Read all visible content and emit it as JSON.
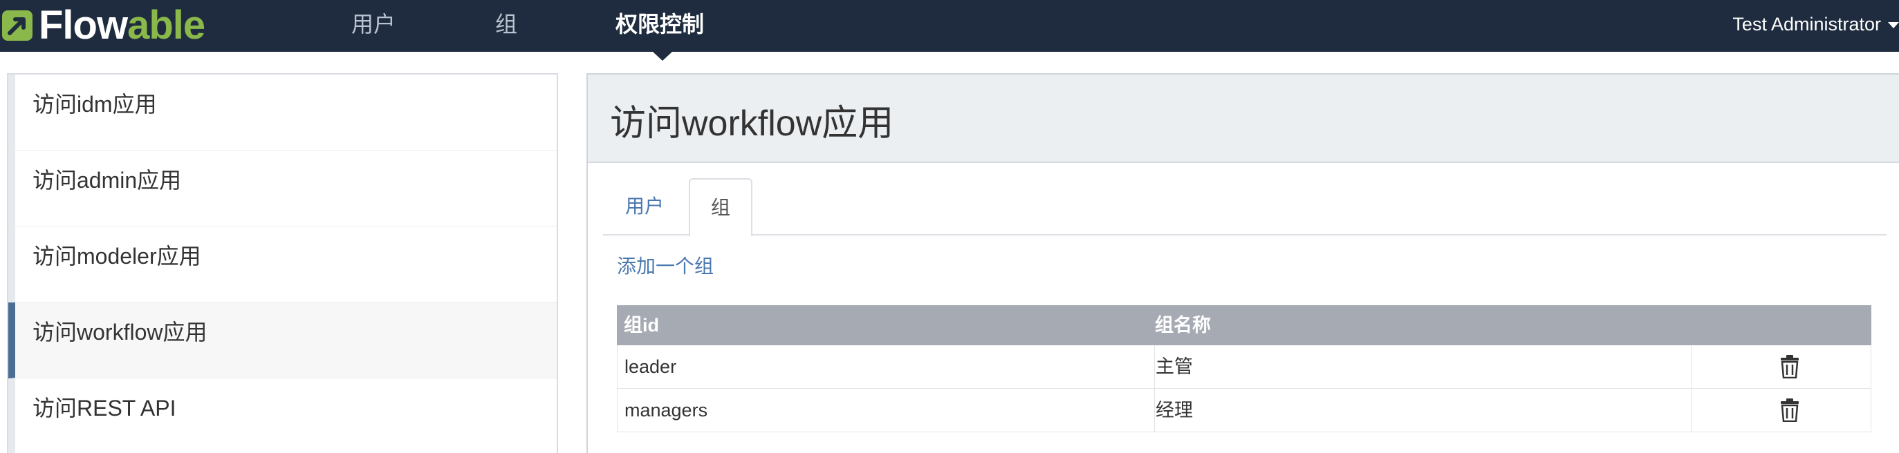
{
  "app": {
    "logo_text_main": "Flow",
    "logo_text_accent": "able"
  },
  "nav": {
    "items": [
      {
        "label": "用户"
      },
      {
        "label": "组"
      },
      {
        "label": "权限控制"
      }
    ],
    "active_index": 2,
    "user": "Test Administrator"
  },
  "sidebar": {
    "items": [
      {
        "label": "访问idm应用"
      },
      {
        "label": "访问admin应用"
      },
      {
        "label": "访问modeler应用"
      },
      {
        "label": "访问workflow应用"
      },
      {
        "label": "访问REST API"
      }
    ],
    "active_index": 3
  },
  "main": {
    "title": "访问workflow应用",
    "tabs": [
      {
        "label": "用户"
      },
      {
        "label": "组"
      }
    ],
    "active_tab": 1,
    "add_link": "添加一个组",
    "table": {
      "headers": [
        "组id",
        "组名称"
      ],
      "rows": [
        {
          "id": "leader",
          "name": "主管"
        },
        {
          "id": "managers",
          "name": "经理"
        }
      ]
    }
  },
  "colors": {
    "navbar": "#1f2c3f",
    "brand_green": "#8ab84a",
    "link": "#4a78b0",
    "table_header": "#a6aab3",
    "active_sidebar_accent": "#4a6d94"
  }
}
